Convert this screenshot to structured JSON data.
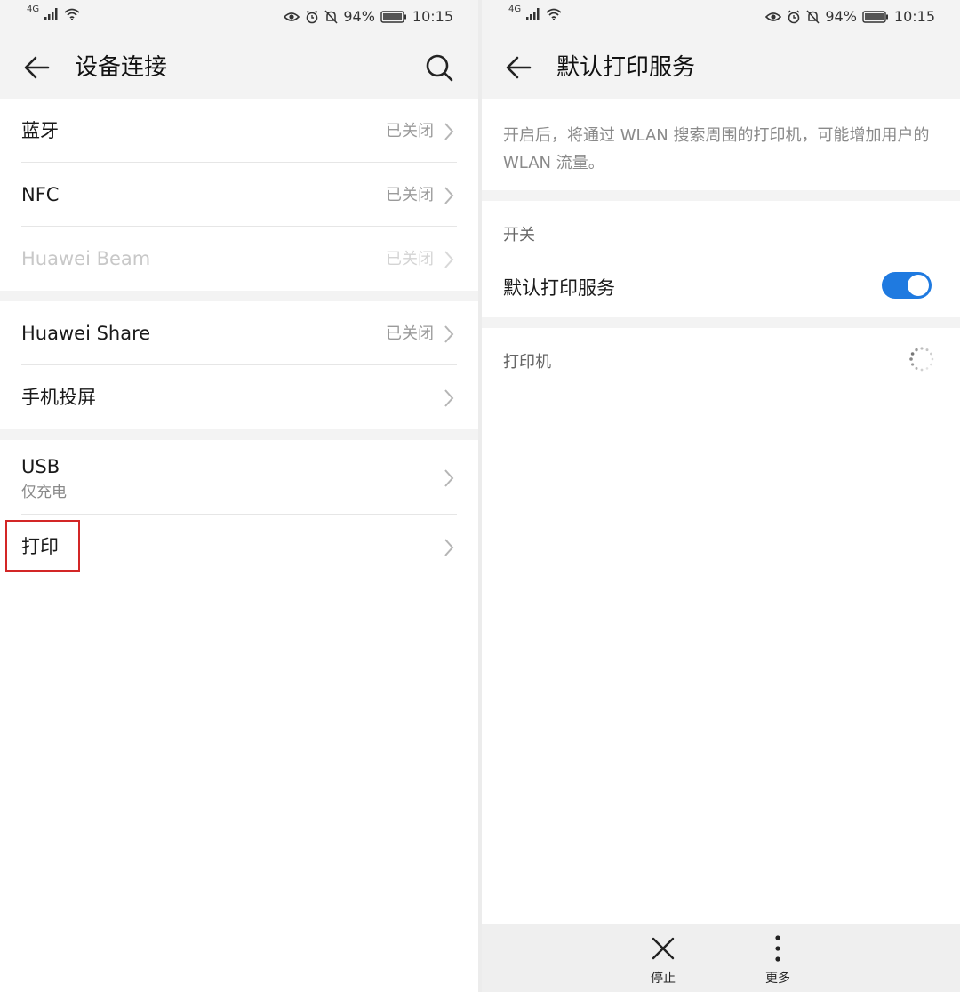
{
  "left": {
    "status": {
      "network": "4G",
      "battery": "94%",
      "time": "10:15"
    },
    "header": {
      "title": "设备连接"
    },
    "rows": [
      {
        "label": "蓝牙",
        "value": "已关闭"
      },
      {
        "label": "NFC",
        "value": "已关闭"
      },
      {
        "label": "Huawei Beam",
        "value": "已关闭"
      },
      {
        "label": "Huawei Share",
        "value": "已关闭"
      },
      {
        "label": "手机投屏",
        "value": ""
      },
      {
        "label": "USB",
        "sublabel": "仅充电"
      },
      {
        "label": "打印",
        "value": ""
      }
    ]
  },
  "right": {
    "status": {
      "network": "4G",
      "battery": "94%",
      "time": "10:15"
    },
    "header": {
      "title": "默认打印服务"
    },
    "description": "开启后，将通过 WLAN 搜索周围的打印机，可能增加用户的 WLAN 流量。",
    "switch_section": {
      "title": "开关",
      "toggle_label": "默认打印服务",
      "toggle_on": true
    },
    "printer_section": {
      "title": "打印机"
    },
    "bottom_bar": {
      "stop_label": "停止",
      "more_label": "更多"
    },
    "accent_color": "#1f7ae0"
  }
}
